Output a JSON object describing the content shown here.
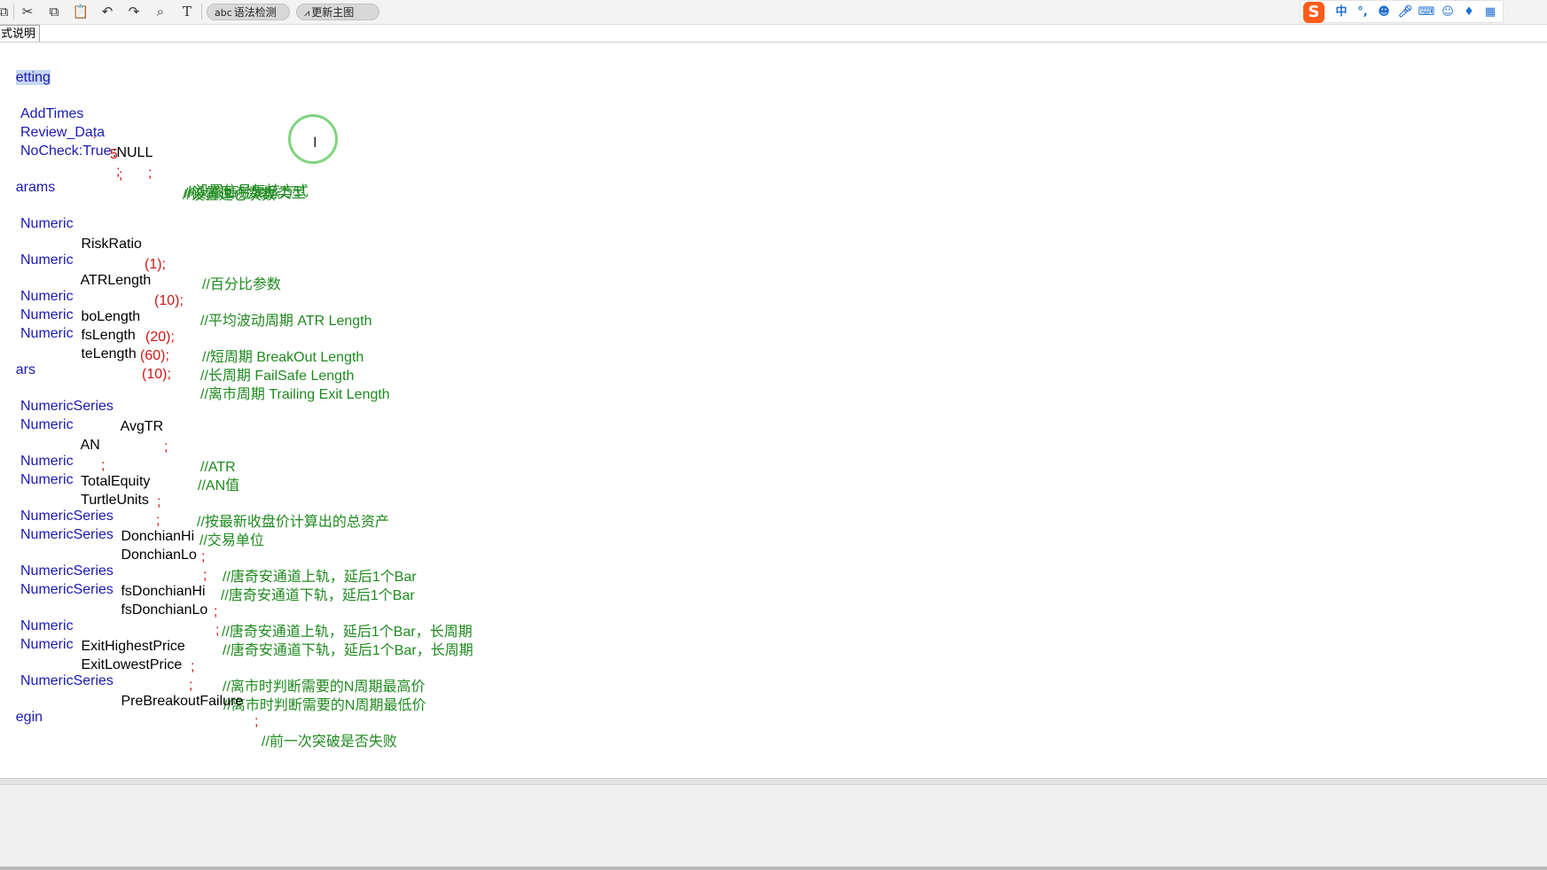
{
  "toolbar": {
    "icons": [
      "copy-icon",
      "cut-icon",
      "copy-icon",
      "paste-icon",
      "undo-icon",
      "redo-icon",
      "search-icon",
      "text-icon"
    ],
    "syntax_check": {
      "icon": "abc",
      "label": "语法检测"
    },
    "update_chart": {
      "label": "更新主图"
    }
  },
  "ime": {
    "logo": "S",
    "mode": "中"
  },
  "tab": {
    "label": "式说明"
  },
  "code": {
    "l1": "etting",
    "l2_kw": "AddTimes",
    "l2_colon": " : ",
    "l2_num": "5",
    "l2_semi": ";",
    "l2_cm": "//设置建仓次数",
    "l3_kw": "Review_Data",
    "l3_val": ":NULL",
    "l3_semi": ";",
    "l3_cm": "//设置回测数据类型",
    "l4_kw": "NoCheck:True",
    "l4_semi": ";",
    "l4_cm": "//设置信号复核方式",
    "l5": "arams",
    "l6_kw": "Numeric",
    "l6_name": " RiskRatio",
    "l6_num": "(1);",
    "l6_cm": "//百分比参数",
    "l7_kw": "Numeric",
    "l7_name": " ATRLength",
    "l7_num": "(10);",
    "l7_cm": "//平均波动周期 ATR Length",
    "l8_kw": "Numeric",
    "l8_name": " boLength",
    "l8_num": "(20);",
    "l8_cm": "//短周期 BreakOut Length",
    "l9_kw": "Numeric",
    "l9_name": " fsLength",
    "l9_num": "(60);",
    "l9_cm": "//长周期 FailSafe Length",
    "l10_kw": "Numeric",
    "l10_name": " teLength",
    "l10_num": "(10);",
    "l10_cm": "//离市周期 Trailing Exit Length",
    "l11": "ars",
    "l12_kw": "NumericSeries",
    "l12_name": " AvgTR",
    "l12_semi": ";",
    "l12_cm": "//ATR",
    "l13_kw": "Numeric",
    "l13_name": " AN",
    "l13_semi": ";",
    "l13_cm": "//AN值",
    "l14_kw": "Numeric",
    "l14_name": " TotalEquity",
    "l14_semi": ";",
    "l14_cm": "//按最新收盘价计算出的总资产",
    "l15_kw": "Numeric",
    "l15_name": " TurtleUnits",
    "l15_semi": ";",
    "l15_cm": "//交易单位",
    "l16_kw": "NumericSeries",
    "l16_name": " DonchianHi",
    "l16_semi": ";",
    "l16_cm": "//唐奇安通道上轨，延后1个Bar",
    "l17_kw": "NumericSeries",
    "l17_name": " DonchianLo",
    "l17_semi": ";",
    "l17_cm": "//唐奇安通道下轨，延后1个Bar",
    "l18_kw": "NumericSeries",
    "l18_name": " fsDonchianHi",
    "l18_semi": ";",
    "l18_cm": "//唐奇安通道上轨，延后1个Bar，长周期",
    "l19_kw": "NumericSeries",
    "l19_name": " fsDonchianLo",
    "l19_semi": ";",
    "l19_cm": "//唐奇安通道下轨，延后1个Bar，长周期",
    "l20_kw": "Numeric",
    "l20_name": " ExitHighestPrice",
    "l20_semi": ";",
    "l20_cm": "//离市时判断需要的N周期最高价",
    "l21_kw": "Numeric",
    "l21_name": " ExitLowestPrice",
    "l21_semi": ";",
    "l21_cm": "//离市时判断需要的N周期最低价",
    "l22_kw": "NumericSeries",
    "l22_name": " PreBreakoutFailure",
    "l22_semi": ";",
    "l22_cm": "//前一次突破是否失败",
    "l23": "egin"
  },
  "colors": {
    "keyword": "#1a1ab2",
    "number": "#d01616",
    "comment": "#1f8a1f",
    "selection": "#c7d7f2"
  }
}
